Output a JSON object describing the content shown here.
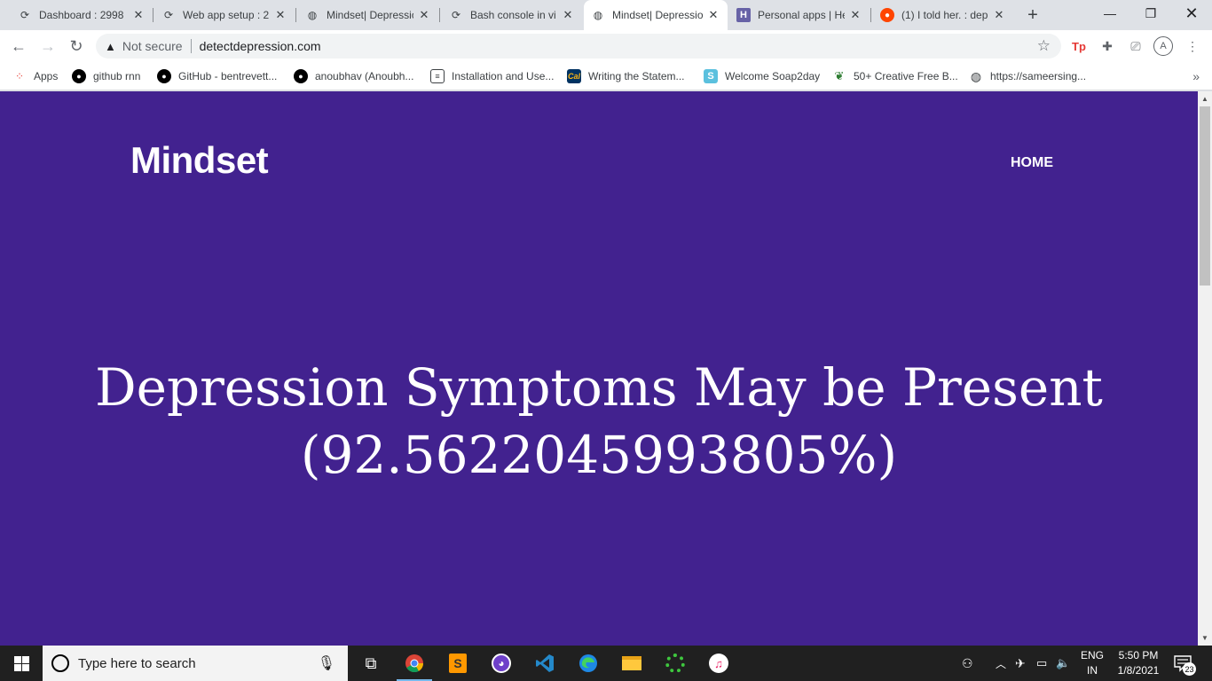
{
  "tabs": [
    {
      "title": "Dashboard : 2998",
      "favicon": "loading-spinner-icon"
    },
    {
      "title": "Web app setup : 2",
      "favicon": "loading-spinner-icon"
    },
    {
      "title": "Mindset| Depressio",
      "favicon": "globe-icon"
    },
    {
      "title": "Bash console in vi",
      "favicon": "loading-spinner-icon"
    },
    {
      "title": "Mindset| Depressio",
      "favicon": "globe-icon",
      "active": true
    },
    {
      "title": "Personal apps | He",
      "favicon": "heroku-icon"
    },
    {
      "title": "(1) I told her. : dep",
      "favicon": "reddit-icon"
    }
  ],
  "omnibox": {
    "security": "Not secure",
    "url": "detectdepression.com"
  },
  "bookmarks": [
    {
      "label": "Apps",
      "icon": "apps-grid-icon"
    },
    {
      "label": "github rnn",
      "icon": "github-icon"
    },
    {
      "label": "GitHub - bentrevett...",
      "icon": "github-icon"
    },
    {
      "label": "anoubhav (Anoubh...",
      "icon": "github-icon"
    },
    {
      "label": "Installation and Use...",
      "icon": "document-icon"
    },
    {
      "label": "Writing the Statem...",
      "icon": "cal-icon"
    },
    {
      "label": "Welcome Soap2day",
      "icon": "soap2day-icon"
    },
    {
      "label": "50+ Creative Free B...",
      "icon": "bird-icon"
    },
    {
      "label": "https://sameersing...",
      "icon": "globe-icon"
    }
  ],
  "page": {
    "brand": "Mindset",
    "nav_home": "HOME",
    "headline_line1": "Depression Symptoms May be Present",
    "headline_line2": "(92.56220459938​05%)",
    "bg_color": "#42228f"
  },
  "taskbar": {
    "search_placeholder": "Type here to search",
    "lang_top": "ENG",
    "lang_bottom": "IN",
    "time": "5:50 PM",
    "date": "1/8/2021",
    "notification_count": "23"
  }
}
